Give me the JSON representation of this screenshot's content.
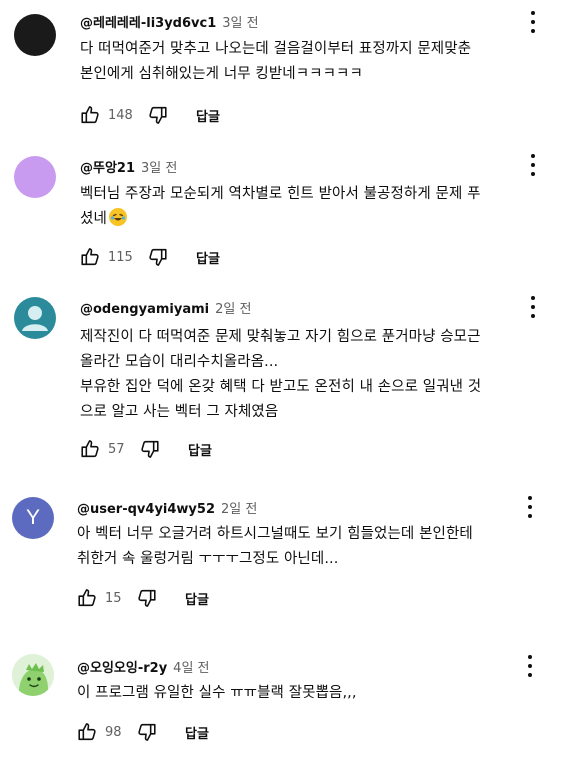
{
  "colors": {
    "text_primary": "#0f0f0f",
    "text_secondary": "#606060",
    "avatar_dark": "#1a1a1a",
    "avatar_lavender": "#c89bf0",
    "avatar_teal": "#2b8b9a",
    "avatar_indigo": "#5c6bc0",
    "avatar_green": "#9ed58a"
  },
  "icons": {
    "like": "thumbs-up-icon",
    "dislike": "thumbs-down-icon",
    "menu": "more-vert-icon"
  },
  "comments": [
    {
      "author": "@레레레레-li3yd6vc1",
      "time": "3일 전",
      "lines": [
        "다 떠먹여준거 맞추고 나오는데 걸음걸이부터 표정까지 문제맞춘",
        "본인에게 심취해있는게 너무 킹받네ㅋㅋㅋㅋㅋ"
      ],
      "likes": "148",
      "reply_label": "답글"
    },
    {
      "author": "@뚜앙21",
      "time": "3일 전",
      "lines": [
        "벡터님 주장과 모순되게 역차별로 힌트 받아서 불공정하게 문제 푸",
        "셨네"
      ],
      "likes": "115",
      "reply_label": "답글"
    },
    {
      "author": "@odengyamiyami",
      "time": "2일 전",
      "lines": [
        "제작진이 다 떠먹여준 문제 맞춰놓고 자기 힘으로 푼거마냥 승모근",
        "올라간 모습이 대리수치올라옴...",
        "부유한 집안 덕에 온갖 혜택 다 받고도 온전히 내 손으로 일궈낸 것",
        "으로 알고 사는 벡터 그 자체였음"
      ],
      "likes": "57",
      "reply_label": "답글"
    },
    {
      "author": "@user-qv4yi4wy52",
      "time": "2일 전",
      "avatar_letter": "Y",
      "lines": [
        "아 벡터 너무 오글거려 하트시그널때도 보기 힘들었는데 본인한테",
        "취한거 속 울렁거림 ㅜㅜㅜ그정도 아닌데..."
      ],
      "likes": "15",
      "reply_label": "답글"
    },
    {
      "author": "@오잉오잉-r2y",
      "time": "4일 전",
      "lines": [
        "이 프로그램 유일한 실수 ㅠㅠ블랙 잘못뽑음,,,"
      ],
      "likes": "98",
      "reply_label": "답글"
    }
  ]
}
